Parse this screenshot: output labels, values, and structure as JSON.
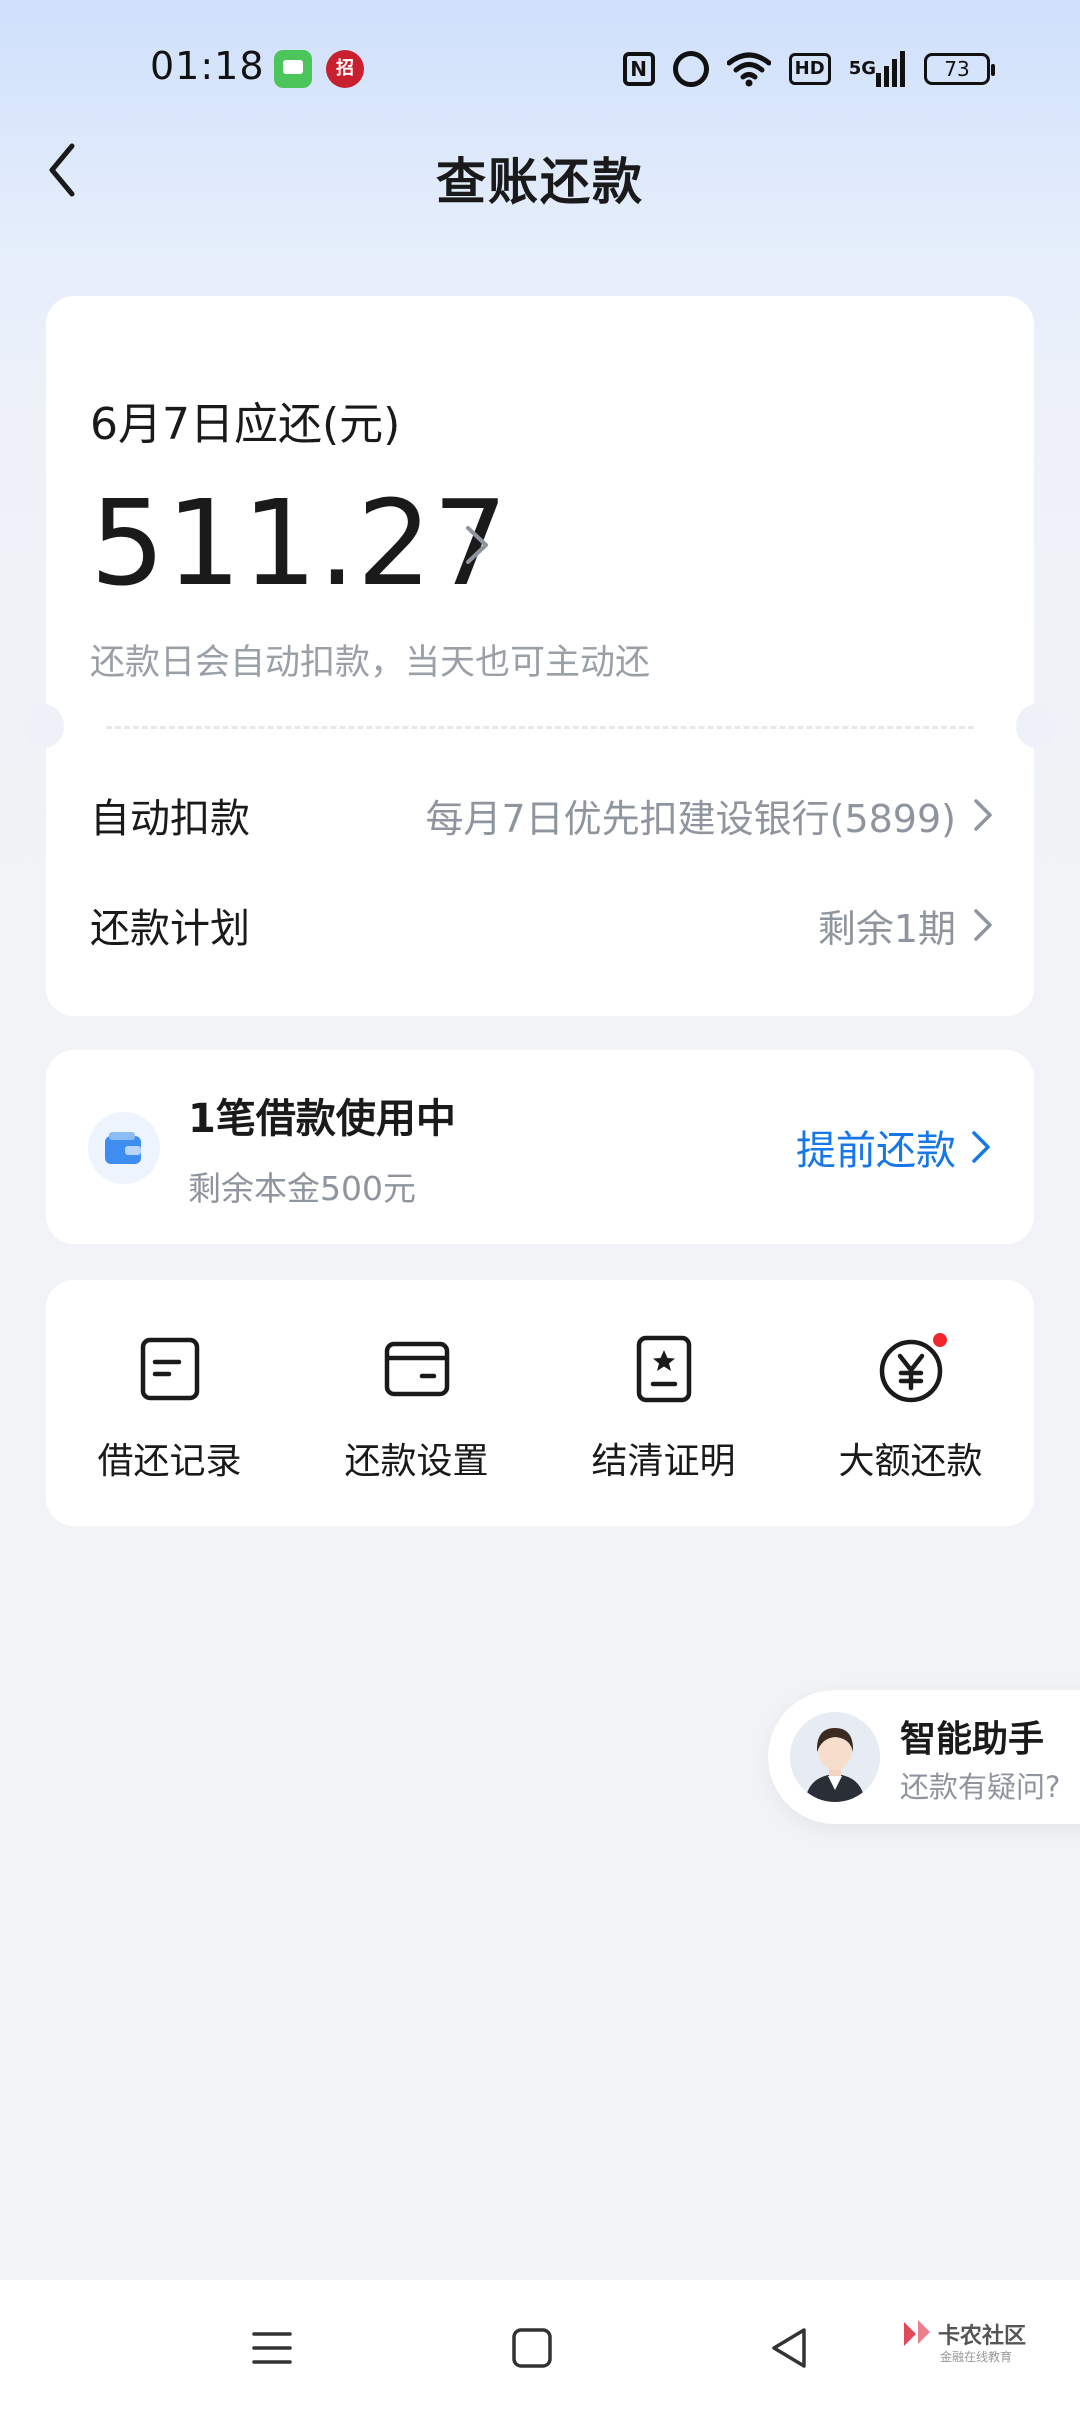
{
  "status_bar": {
    "time": "01:18",
    "bank_icon_text": "招",
    "network": "5G",
    "hd": "HD",
    "battery": "73",
    "nfc": "N"
  },
  "header": {
    "title": "查账还款",
    "back_icon": "chevron-left-icon"
  },
  "bill": {
    "due_label": "6月7日应还(元)",
    "amount": "511.27",
    "note": "还款日会自动扣款，当天也可主动还",
    "rows": [
      {
        "label": "自动扣款",
        "value": "每月7日优先扣建设银行(5899)"
      },
      {
        "label": "还款计划",
        "value": "剩余1期"
      }
    ]
  },
  "loan": {
    "title": "1笔借款使用中",
    "subtitle": "剩余本金500元",
    "action": "提前还款",
    "accent": "#1677e6"
  },
  "actions": [
    {
      "label": "借还记录",
      "icon": "record-icon"
    },
    {
      "label": "还款设置",
      "icon": "card-wallet-icon"
    },
    {
      "label": "结清证明",
      "icon": "certificate-icon"
    },
    {
      "label": "大额还款",
      "icon": "yen-circle-icon",
      "badge": true
    }
  ],
  "assistant": {
    "title": "智能助手",
    "subtitle": "还款有疑问?"
  },
  "watermark": {
    "main": "卡农社区",
    "sub": "金融在线教育"
  }
}
